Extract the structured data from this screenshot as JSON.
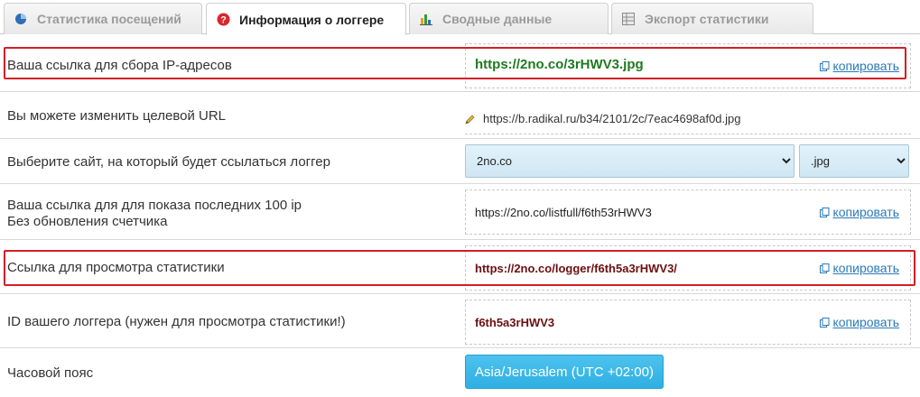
{
  "tabs": [
    {
      "label": "Статистика посещений",
      "icon": "pie-chart-icon",
      "active": false
    },
    {
      "label": "Информация о логгере",
      "icon": "info-icon",
      "active": true
    },
    {
      "label": "Сводные данные",
      "icon": "bar-chart-icon",
      "active": false
    },
    {
      "label": "Экспорт статистики",
      "icon": "table-icon",
      "active": false
    }
  ],
  "rows": {
    "ip_link": {
      "label": "Ваша ссылка для сбора IP-адресов",
      "value": "https://2no.co/3rHWV3.jpg",
      "copy": "копировать"
    },
    "target_url": {
      "label": "Вы можете изменить целевой URL",
      "value": "https://b.radikal.ru/b34/2101/2c/7eac4698af0d.jpg"
    },
    "site": {
      "label": "Выберите сайт, на который будет ссылаться логгер",
      "domain": "2no.co",
      "extension": ".jpg"
    },
    "last100": {
      "label_line1": "Ваша ссылка для для показа последних 100 ip",
      "label_line2": "Без обновления счетчика",
      "value": "https://2no.co/listfull/f6th53rHWV3",
      "copy": "копировать"
    },
    "stats_link": {
      "label": "Ссылка для просмотра статистики",
      "value": "https://2no.co/logger/f6th5a3rHWV3/",
      "copy": "копировать"
    },
    "logger_id": {
      "label": "ID вашего логгера (нужен для просмотра статистики!)",
      "value": "f6th5a3rHWV3",
      "copy": "копировать"
    },
    "timezone": {
      "label": "Часовой пояс",
      "value": "Asia/Jerusalem (UTC +02:00)"
    }
  },
  "colors": {
    "highlight": "#d21f27",
    "green_link": "#1f7a1f",
    "dark_red_link": "#6b0f0f",
    "copy_link": "#2a7ab8",
    "tz_button": "#36b4e5"
  }
}
